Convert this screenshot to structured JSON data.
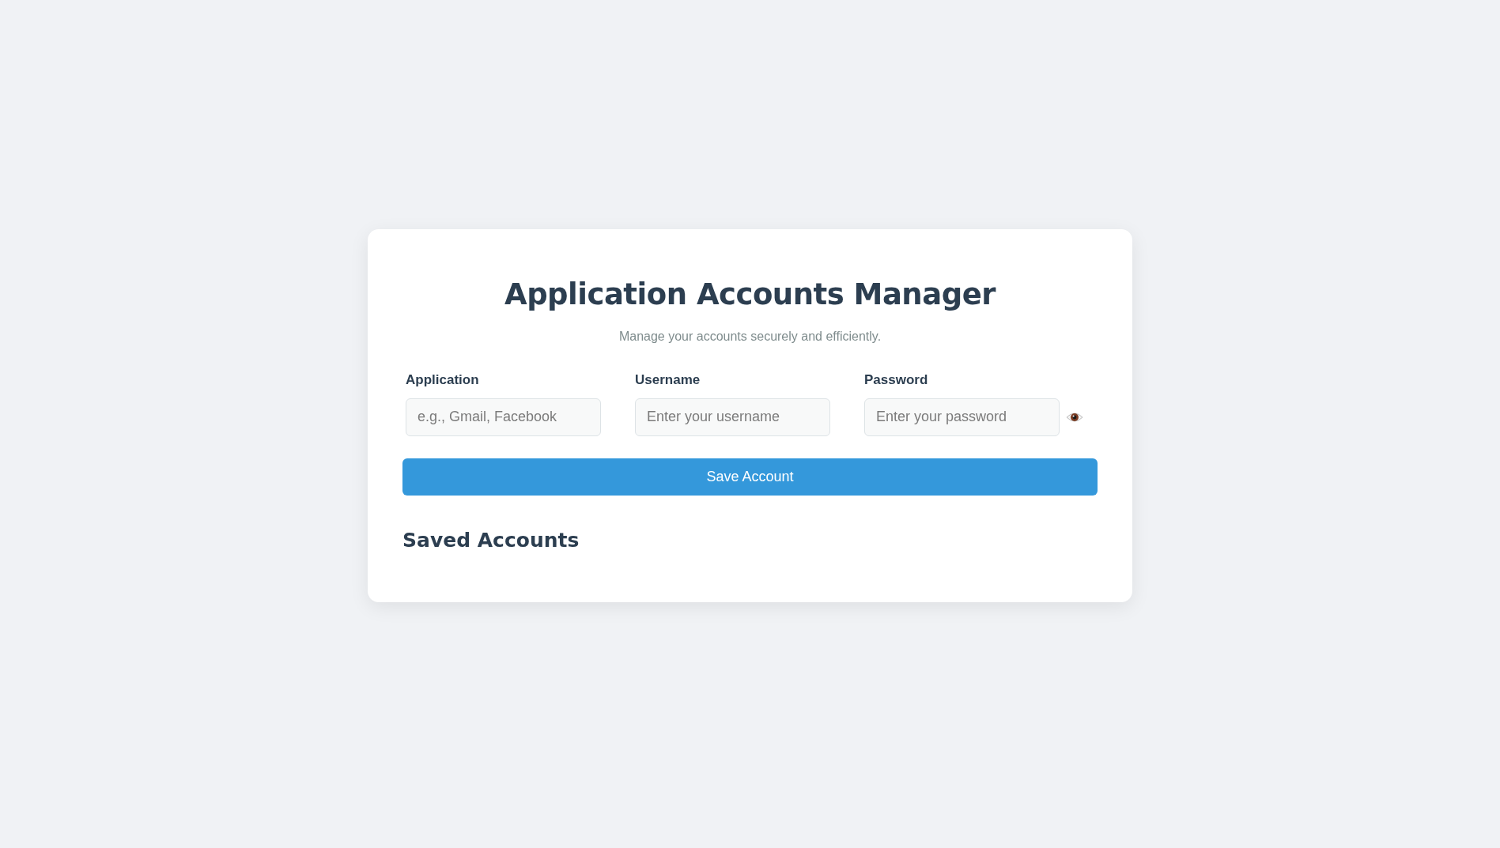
{
  "title": "Application Accounts Manager",
  "subtitle": "Manage your accounts securely and efficiently.",
  "fields": [
    {
      "label": "Application",
      "placeholder": "e.g., Gmail, Facebook",
      "kind": "text"
    },
    {
      "label": "Username",
      "placeholder": "Enter your username",
      "kind": "text"
    },
    {
      "label": "Password",
      "placeholder": "Enter your password",
      "kind": "password"
    }
  ],
  "save_button": "Save Account",
  "saved_heading": "Saved Accounts"
}
